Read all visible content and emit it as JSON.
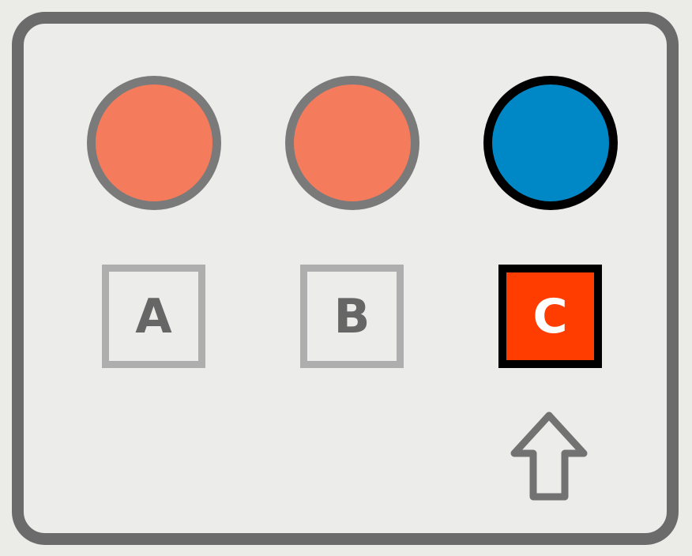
{
  "options": [
    {
      "label": "A",
      "circle_color": "#f47c5c",
      "box_text_color": "#666666",
      "box_fill": "transparent",
      "selected": false
    },
    {
      "label": "B",
      "circle_color": "#f47c5c",
      "box_text_color": "#666666",
      "box_fill": "transparent",
      "selected": false
    },
    {
      "label": "C",
      "circle_color": "#0088c6",
      "box_text_color": "#ffffff",
      "box_fill": "#ff3d00",
      "selected": true
    }
  ],
  "pointer": {
    "icon": "up-arrow-icon",
    "points_to": "C",
    "color": "#727272"
  }
}
